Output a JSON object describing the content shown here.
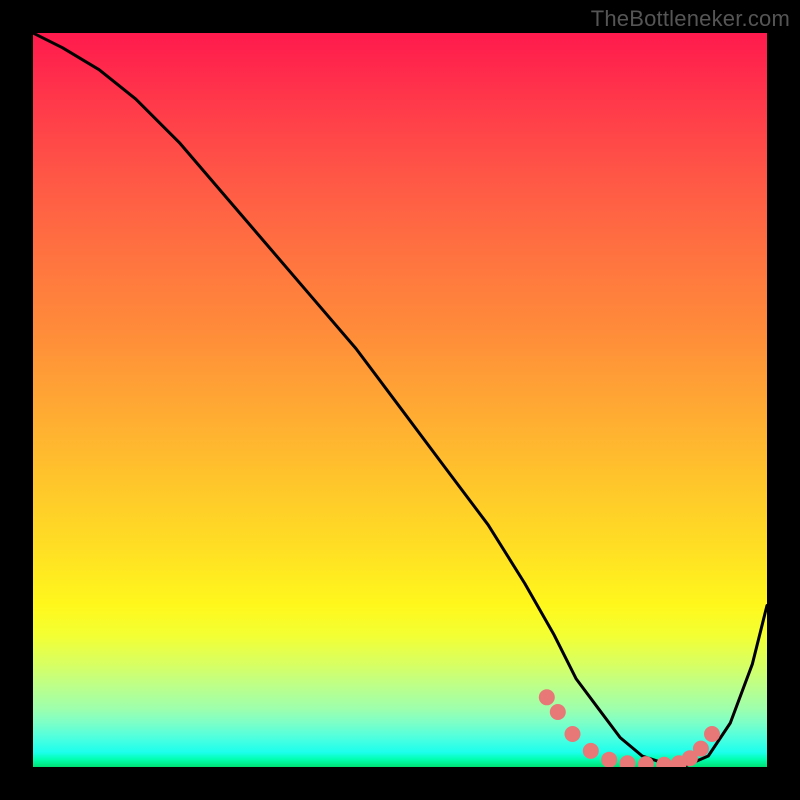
{
  "watermark": "TheBottleneker.com",
  "chart_data": {
    "type": "line",
    "title": "",
    "xlabel": "",
    "ylabel": "",
    "xlim": [
      0,
      100
    ],
    "ylim": [
      0,
      100
    ],
    "series": [
      {
        "name": "bottleneck-curve",
        "x": [
          0,
          4,
          9,
          14,
          20,
          26,
          32,
          38,
          44,
          50,
          56,
          62,
          67,
          71,
          74,
          77,
          80,
          83,
          86,
          89,
          92,
          95,
          98,
          100
        ],
        "y": [
          100,
          98,
          95,
          91,
          85,
          78,
          71,
          64,
          57,
          49,
          41,
          33,
          25,
          18,
          12,
          8,
          4,
          1.5,
          0.5,
          0.2,
          1.5,
          6,
          14,
          22
        ]
      }
    ],
    "markers": {
      "name": "highlight-dots",
      "color": "#e87878",
      "points": [
        {
          "x": 70,
          "y": 9.5
        },
        {
          "x": 71.5,
          "y": 7.5
        },
        {
          "x": 73.5,
          "y": 4.5
        },
        {
          "x": 76,
          "y": 2.2
        },
        {
          "x": 78.5,
          "y": 1.0
        },
        {
          "x": 81,
          "y": 0.5
        },
        {
          "x": 83.5,
          "y": 0.4
        },
        {
          "x": 86,
          "y": 0.3
        },
        {
          "x": 88,
          "y": 0.5
        },
        {
          "x": 89.5,
          "y": 1.2
        },
        {
          "x": 91,
          "y": 2.5
        },
        {
          "x": 92.5,
          "y": 4.5
        }
      ]
    },
    "background_gradient": {
      "top": "#ff1a4d",
      "mid_upper": "#ff8a3a",
      "mid": "#ffde24",
      "lower": "#fff81c",
      "bottom": "#00e074"
    }
  }
}
